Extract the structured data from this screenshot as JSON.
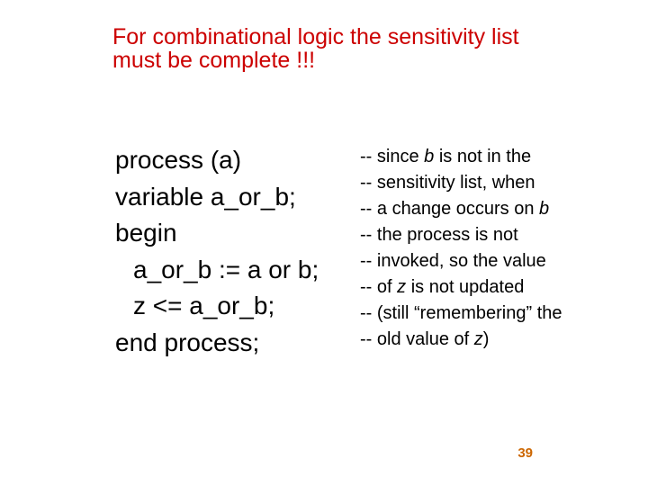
{
  "title": "For combinational logic the sensitivity list must be complete !!!",
  "code": {
    "l1": "process (a)",
    "l2": "variable a_or_b;",
    "l3": "begin",
    "l4": "a_or_b := a or b;",
    "l5": "z <=  a_or_b;",
    "l6": "end process;"
  },
  "comment": {
    "dash": "-- ",
    "c1a": "since ",
    "c1b": "b",
    "c1c": " is not in the",
    "c2": "sensitivity list, when",
    "c3a": "a change occurs on ",
    "c3b": "b",
    "c4": "the process is not",
    "c5": "invoked, so the value",
    "c6a": "of ",
    "c6b": "z",
    "c6c": " is not updated",
    "c7": "(still “remembering” the",
    "c8a": "old value of ",
    "c8b": "z",
    "c8c": ")"
  },
  "page": "39"
}
